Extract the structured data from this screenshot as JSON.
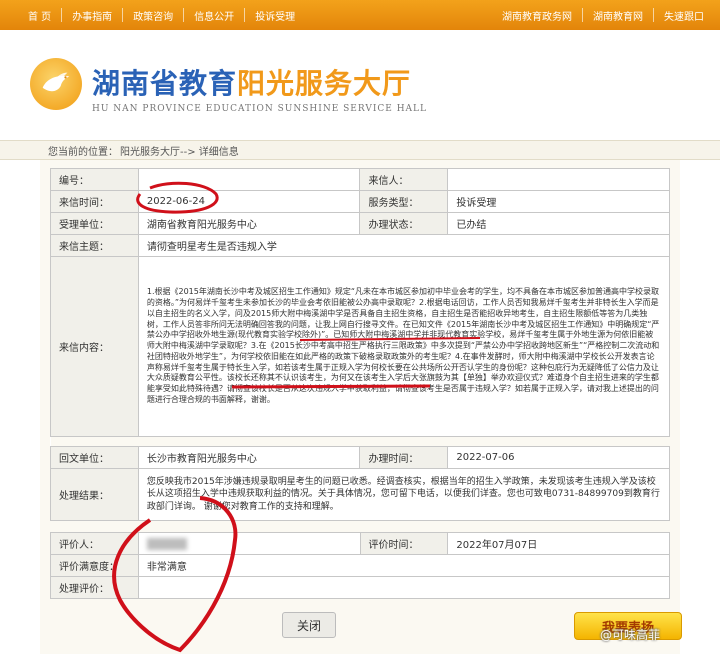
{
  "nav": {
    "items": [
      "首 页",
      "办事指南",
      "政策咨询",
      "信息公开",
      "投诉受理"
    ],
    "right_links": [
      "湖南教育政务网",
      "湖南教育网",
      "失速跟口"
    ]
  },
  "header": {
    "title_part1": "湖南省教育",
    "title_part2": "阳光服务大厅",
    "subtitle": "HU NAN PROVINCE EDUCATION SUNSHINE SERVICE HALL"
  },
  "breadcrumb": {
    "prefix": "您当前的位置：",
    "path": "阳光服务大厅--> 详细信息"
  },
  "detail": {
    "labels": {
      "number": "编号：",
      "sender": "来信人：",
      "date": "来信时间：",
      "service_type": "服务类型：",
      "dept": "受理单位：",
      "status": "办理状态：",
      "subject": "来信主题：",
      "content": "来信内容：",
      "reply_unit": "回文单位：",
      "handle_time": "办理时间：",
      "result": "处理结果：",
      "evaluator": "评价人：",
      "eval_time": "评价时间：",
      "satisfaction": "评价满意度：",
      "eval_comment": "处理评价："
    },
    "values": {
      "number": "",
      "sender": "",
      "date": "2022-06-24",
      "service_type": "投诉受理",
      "dept": "湖南省教育阳光服务中心",
      "status": "已办结",
      "subject": "请彻查明星考生是否违规入学",
      "content": "1.根据《2015年湖南长沙中考及城区招生工作通知》规定“凡未在本市城区参加初中毕业会考的学生，均不具备在本市城区参加普通高中学校录取的资格。”为何易烊千玺考生未参加长沙的毕业会考依旧能被公办高中录取呢？2.根据电话回访，工作人员否知我易烊千玺考生并非特长生入学而是以自主招生的名义入学，问及2015师大附中梅溪湖中学是否具备自主招生资格，自主招生是否能招收异地考生，自主招生限额低等答为几类独树，工作人员答非所问无法明确回答我的问题，让我上网自行搜寻文件。在已知文件《2015年湖南长沙中考及城区招生工作通知》中明确规定“严禁公办中学招收外地生源(现代教育实验学校除外)”。已知师大附中梅溪湖中学并非现代教育实验学校，易烊千玺考生属于外地生源为何依旧能被师大附中梅溪湖中学录取呢？3.在《2015长沙中考高中招生严格执行三限政策》中多次提到“严禁公办中学招收跨地区新生”“严格控制二次流动和社团特招收外地学生”，为何学校依旧能在如此严格的政策下破格录取政策外的考生呢？4.在事件发酵时，师大附中梅溪湖中学校长公开发表言论声称易烊千玺考生属于特长生入学，如若该考生属于正规入学为何校长要在公共场所公开否认学生的身份呢？这种包庇行为无疑降低了公信力及让大众质疑教育公平性。该校长还称其不认识该考生，为何又在该考生入学后大张旗鼓为其【单独】举办欢迎仪式？难道身个自主招生进来的学生都能享受如此特殊待遇？请彻查该校长是否从这次违规入学中获取利益，请彻查该考生是否属于违规入学？如若属于正规入学，请对我上述提出的问题进行合理合规的书面解释，谢谢。",
      "reply_unit": "长沙市教育阳光服务中心",
      "handle_time": "2022-07-06",
      "result": "您反映我市2015年涉嫌违规录取明星考生的问题已收悉。经调查核实，根据当年的招生入学政策，未发现该考生违规入学及该校长从这项招生入学中违规获取利益的情况。关于具体情况，您可留下电话，以便我们详查。您也可致电0731-84899709到教育行政部门详询。 谢谢您对教育工作的支持和理解。",
      "evaluator": "",
      "eval_time": "2022年07月07日",
      "satisfaction": "非常满意",
      "eval_comment": ""
    }
  },
  "buttons": {
    "close": "关闭",
    "evaluate": "我要表扬"
  },
  "watermark": "@可味高菲",
  "colors": {
    "nav_orange": "#f3a21b",
    "title_blue": "#2a62b6",
    "title_orange": "#f1991a",
    "label_bg": "#f1f0ea",
    "annotation_red": "#d0101a"
  }
}
